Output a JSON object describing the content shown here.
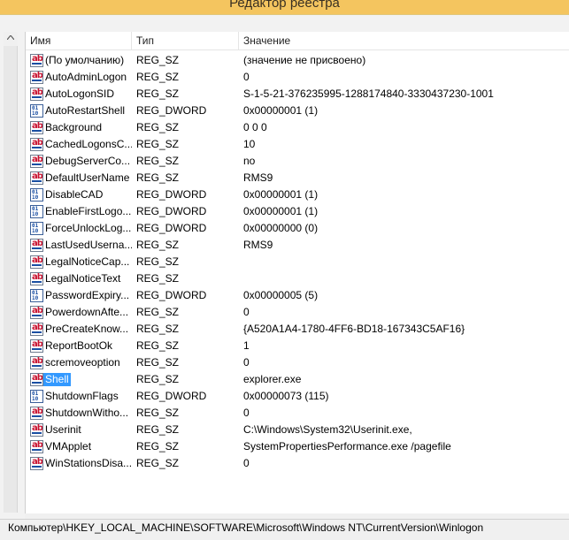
{
  "window": {
    "title": "Редактор реестра"
  },
  "columns": {
    "name": "Имя",
    "type": "Тип",
    "value": "Значение"
  },
  "rows": [
    {
      "name": "(По умолчанию)",
      "type": "REG_SZ",
      "value": "(значение не присвоено)",
      "icon": "string-value-icon"
    },
    {
      "name": "AutoAdminLogon",
      "type": "REG_SZ",
      "value": "0",
      "icon": "string-value-icon"
    },
    {
      "name": "AutoLogonSID",
      "type": "REG_SZ",
      "value": "S-1-5-21-376235995-1288174840-3330437230-1001",
      "icon": "string-value-icon"
    },
    {
      "name": "AutoRestartShell",
      "type": "REG_DWORD",
      "value": "0x00000001 (1)",
      "icon": "dword-value-icon"
    },
    {
      "name": "Background",
      "type": "REG_SZ",
      "value": "0 0 0",
      "icon": "string-value-icon"
    },
    {
      "name": "CachedLogonsC...",
      "type": "REG_SZ",
      "value": "10",
      "icon": "string-value-icon"
    },
    {
      "name": "DebugServerCo...",
      "type": "REG_SZ",
      "value": "no",
      "icon": "string-value-icon"
    },
    {
      "name": "DefaultUserName",
      "type": "REG_SZ",
      "value": "RMS9",
      "icon": "string-value-icon"
    },
    {
      "name": "DisableCAD",
      "type": "REG_DWORD",
      "value": "0x00000001 (1)",
      "icon": "dword-value-icon"
    },
    {
      "name": "EnableFirstLogo...",
      "type": "REG_DWORD",
      "value": "0x00000001 (1)",
      "icon": "dword-value-icon"
    },
    {
      "name": "ForceUnlockLog...",
      "type": "REG_DWORD",
      "value": "0x00000000 (0)",
      "icon": "dword-value-icon"
    },
    {
      "name": "LastUsedUserna...",
      "type": "REG_SZ",
      "value": "RMS9",
      "icon": "string-value-icon"
    },
    {
      "name": "LegalNoticeCap...",
      "type": "REG_SZ",
      "value": "",
      "icon": "string-value-icon"
    },
    {
      "name": "LegalNoticeText",
      "type": "REG_SZ",
      "value": "",
      "icon": "string-value-icon"
    },
    {
      "name": "PasswordExpiry...",
      "type": "REG_DWORD",
      "value": "0x00000005 (5)",
      "icon": "dword-value-icon"
    },
    {
      "name": "PowerdownAfte...",
      "type": "REG_SZ",
      "value": "0",
      "icon": "string-value-icon"
    },
    {
      "name": "PreCreateKnow...",
      "type": "REG_SZ",
      "value": "{A520A1A4-1780-4FF6-BD18-167343C5AF16}",
      "icon": "string-value-icon"
    },
    {
      "name": "ReportBootOk",
      "type": "REG_SZ",
      "value": "1",
      "icon": "string-value-icon"
    },
    {
      "name": "scremoveoption",
      "type": "REG_SZ",
      "value": "0",
      "icon": "string-value-icon"
    },
    {
      "name": "Shell",
      "type": "REG_SZ",
      "value": "explorer.exe",
      "icon": "string-value-icon",
      "selected": true
    },
    {
      "name": "ShutdownFlags",
      "type": "REG_DWORD",
      "value": "0x00000073 (115)",
      "icon": "dword-value-icon"
    },
    {
      "name": "ShutdownWitho...",
      "type": "REG_SZ",
      "value": "0",
      "icon": "string-value-icon"
    },
    {
      "name": "Userinit",
      "type": "REG_SZ",
      "value": "C:\\Windows\\System32\\Userinit.exe,",
      "icon": "string-value-icon"
    },
    {
      "name": "VMApplet",
      "type": "REG_SZ",
      "value": "SystemPropertiesPerformance.exe /pagefile",
      "icon": "string-value-icon"
    },
    {
      "name": "WinStationsDisa...",
      "type": "REG_SZ",
      "value": "0",
      "icon": "string-value-icon"
    }
  ],
  "status": {
    "path": "Компьютер\\HKEY_LOCAL_MACHINE\\SOFTWARE\\Microsoft\\Windows NT\\CurrentVersion\\Winlogon"
  },
  "colors": {
    "titlebar": "#f4c55f",
    "selection": "#3399ff",
    "string_icon_text": "#c8102e",
    "dword_icon_text": "#1a4fa3"
  }
}
